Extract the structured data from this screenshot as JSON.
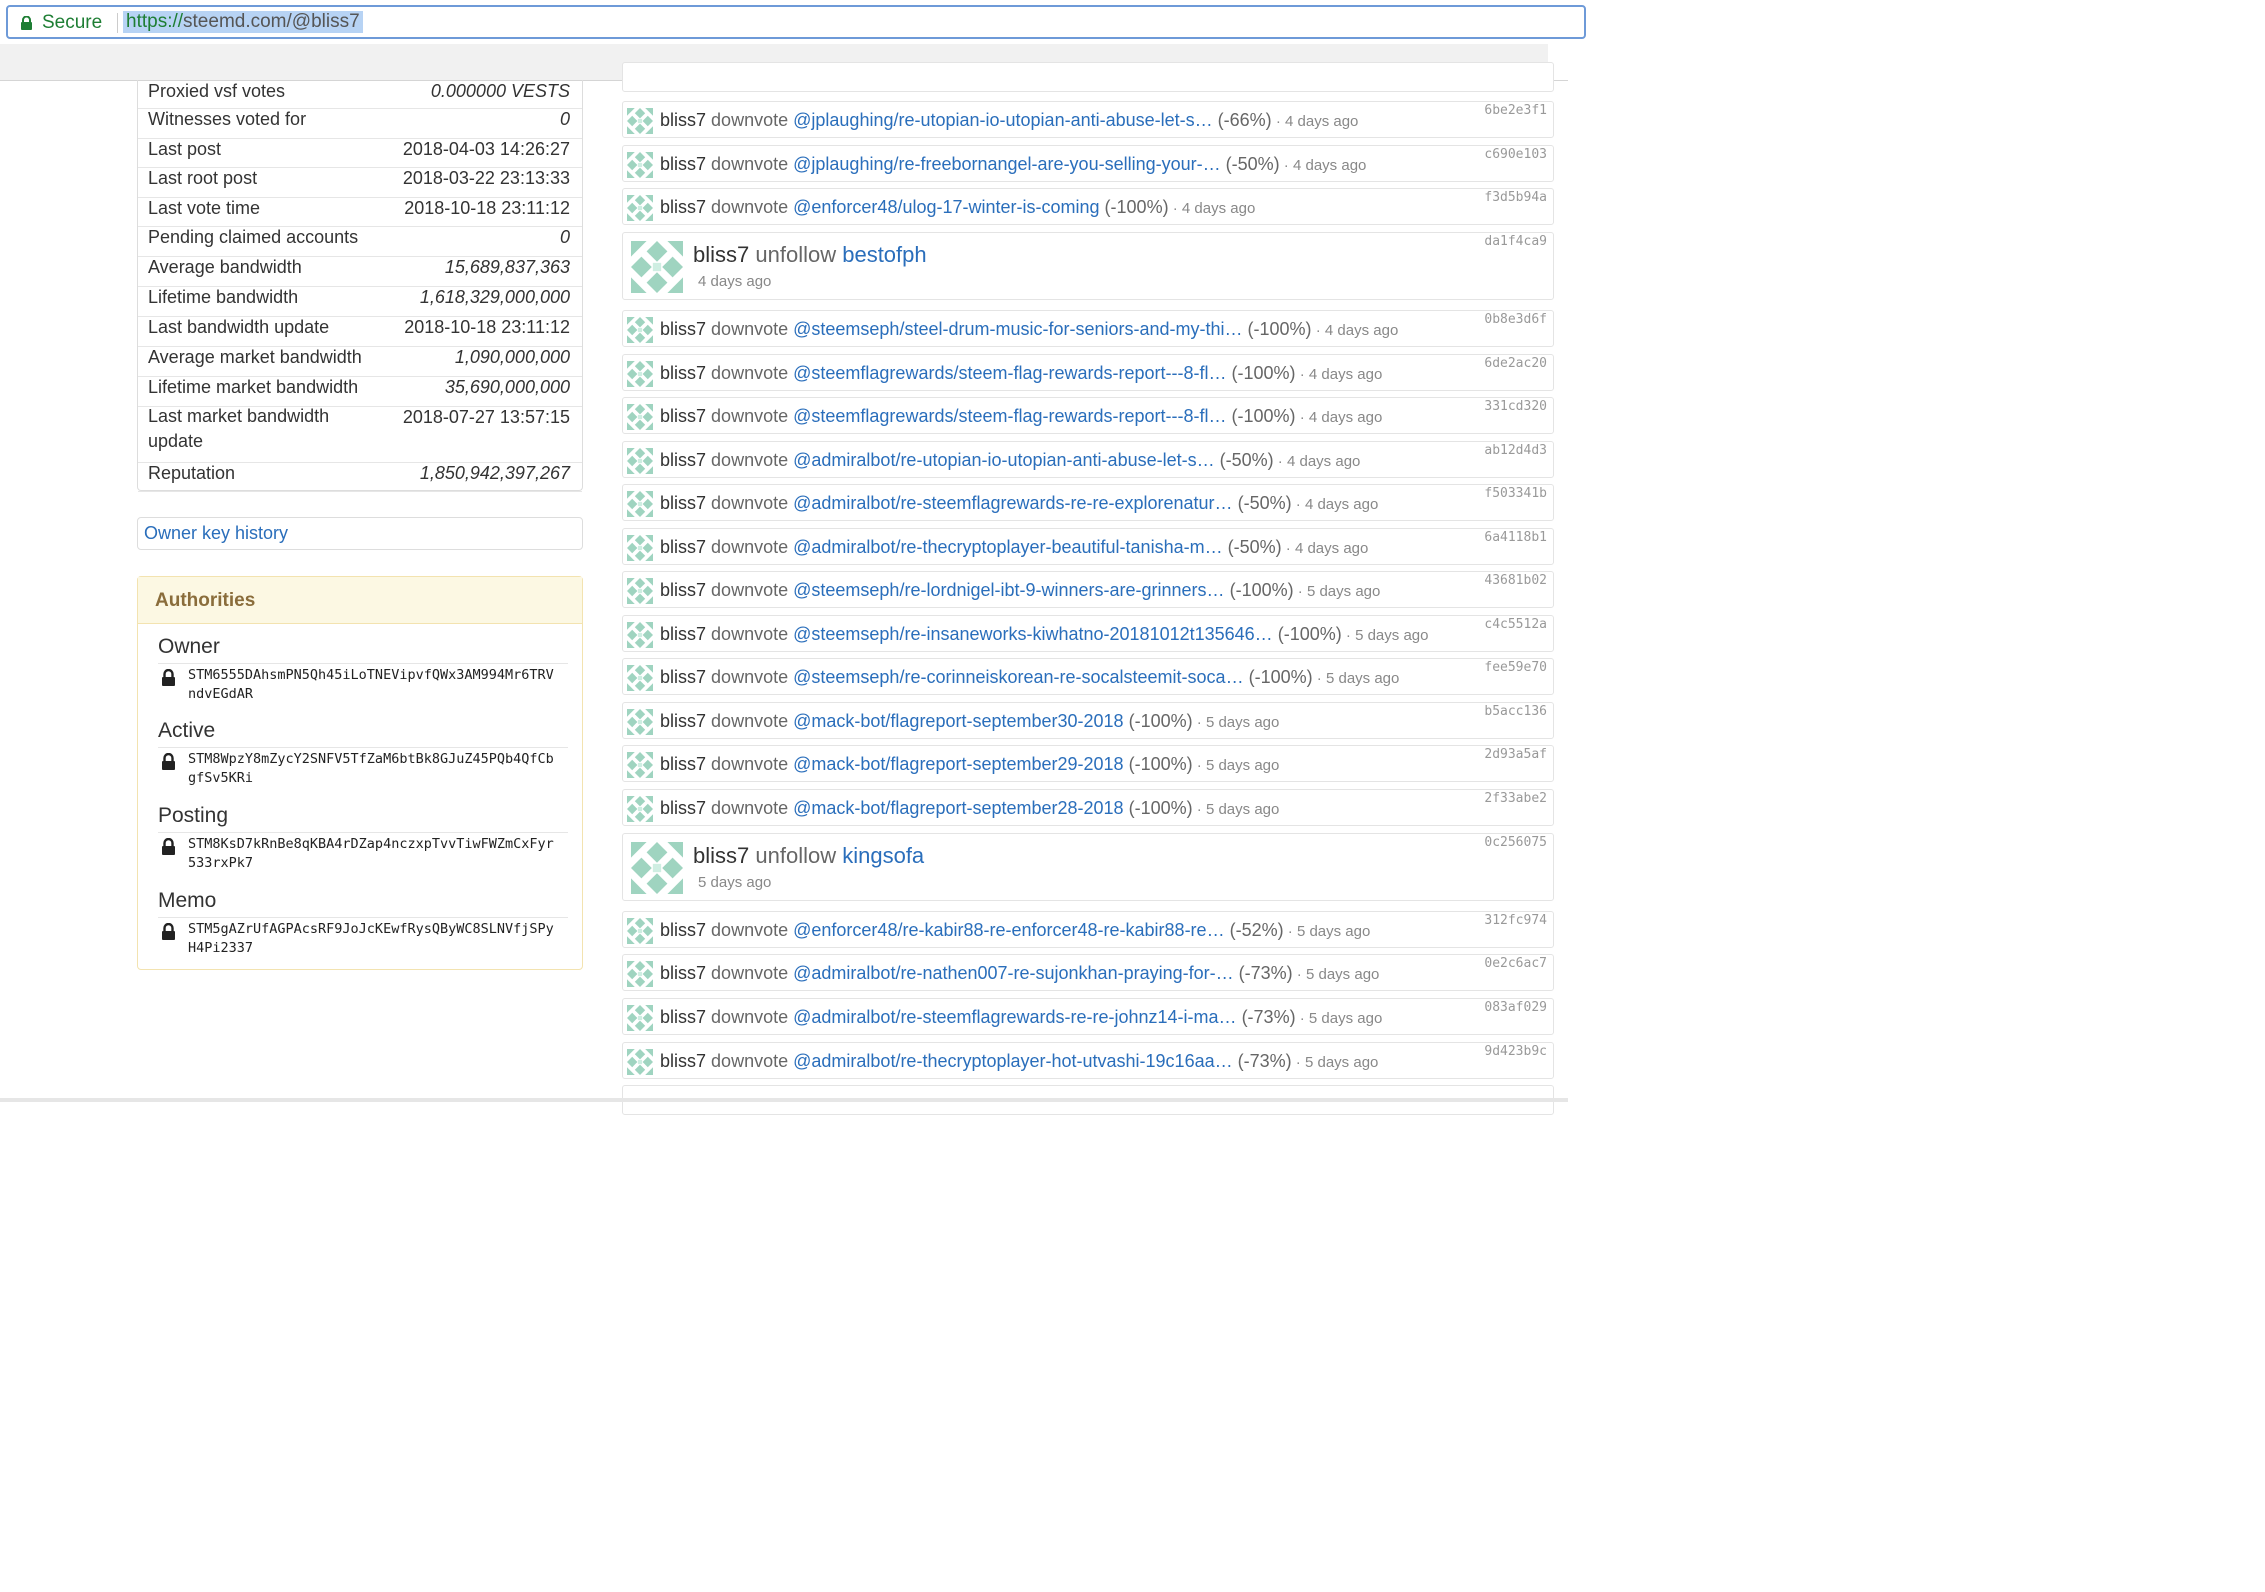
{
  "browser": {
    "secure_label": "Secure",
    "url_protocol": "https://",
    "url_rest": "steemd.com/@bliss7"
  },
  "stats": [
    {
      "label": "Proxied vsf votes",
      "value": "0.000000 VESTS",
      "italic": true
    },
    {
      "label": "Witnesses voted for",
      "value": "0",
      "italic": true
    },
    {
      "label": "Last post",
      "value": "2018-04-03 14:26:27",
      "italic": false
    },
    {
      "label": "Last root post",
      "value": "2018-03-22 23:13:33",
      "italic": false
    },
    {
      "label": "Last vote time",
      "value": "2018-10-18 23:11:12",
      "italic": false
    },
    {
      "label": "Pending claimed accounts",
      "value": "0",
      "italic": true
    },
    {
      "label": "Average bandwidth",
      "value": "15,689,837,363",
      "italic": true
    },
    {
      "label": "Lifetime bandwidth",
      "value": "1,618,329,000,000",
      "italic": true
    },
    {
      "label": "Last bandwidth update",
      "value": "2018-10-18 23:11:12",
      "italic": false
    },
    {
      "label": "Average market bandwidth",
      "value": "1,090,000,000",
      "italic": true
    },
    {
      "label": "Lifetime market bandwidth",
      "value": "35,690,000,000",
      "italic": true
    },
    {
      "label": "Last market bandwidth update",
      "value": "2018-07-27 13:57:15",
      "italic": false
    },
    {
      "label": "Reputation",
      "value": "1,850,942,397,267",
      "italic": true
    }
  ],
  "owner_key_history": "Owner key history",
  "authorities": {
    "title": "Authorities",
    "keys": [
      {
        "name": "Owner",
        "key": "STM6555DAhsmPN5Qh45iLoTNEVipvfQWx3AM994Mr6TRVndvEGdAR"
      },
      {
        "name": "Active",
        "key": "STM8WpzY8mZycY2SNFV5TfZaM6btBk8GJuZ45PQb4QfCbgfSv5KRi"
      },
      {
        "name": "Posting",
        "key": "STM8KsD7kRnBe8qKBA4rDZap4nczxpTvvTiwFWZmCxFyr533rxPk7"
      },
      {
        "name": "Memo",
        "key": "STM5gAZrUfAGPAcsRF9JoJcKEwfRysQByWC8SLNVfjSPyH4Pi2337"
      }
    ]
  },
  "feed": [
    {
      "kind": "vote",
      "who": "bliss7",
      "action": "downvote",
      "link": "@jplaughing/re-utopian-io-utopian-anti-abuse-let-s…",
      "pct": "(-66%)",
      "ago": "4 days ago",
      "hash": "6be2e3f1"
    },
    {
      "kind": "vote",
      "who": "bliss7",
      "action": "downvote",
      "link": "@jplaughing/re-freebornangel-are-you-selling-your-…",
      "pct": "(-50%)",
      "ago": "4 days ago",
      "hash": "c690e103"
    },
    {
      "kind": "vote",
      "who": "bliss7",
      "action": "downvote",
      "link": "@enforcer48/ulog-17-winter-is-coming",
      "pct": "(-100%)",
      "ago": "4 days ago",
      "hash": "f3d5b94a"
    },
    {
      "kind": "follow",
      "who": "bliss7",
      "action": "unfollow",
      "link": "bestofph",
      "ago": "4 days ago",
      "hash": "da1f4ca9"
    },
    {
      "kind": "vote",
      "who": "bliss7",
      "action": "downvote",
      "link": "@steemseph/steel-drum-music-for-seniors-and-my-thi…",
      "pct": "(-100%)",
      "ago": "4 days ago",
      "hash": "0b8e3d6f"
    },
    {
      "kind": "vote",
      "who": "bliss7",
      "action": "downvote",
      "link": "@steemflagrewards/steem-flag-rewards-report---8-fl…",
      "pct": "(-100%)",
      "ago": "4 days ago",
      "hash": "6de2ac20"
    },
    {
      "kind": "vote",
      "who": "bliss7",
      "action": "downvote",
      "link": "@steemflagrewards/steem-flag-rewards-report---8-fl…",
      "pct": "(-100%)",
      "ago": "4 days ago",
      "hash": "331cd320"
    },
    {
      "kind": "vote",
      "who": "bliss7",
      "action": "downvote",
      "link": "@admiralbot/re-utopian-io-utopian-anti-abuse-let-s…",
      "pct": "(-50%)",
      "ago": "4 days ago",
      "hash": "ab12d4d3"
    },
    {
      "kind": "vote",
      "who": "bliss7",
      "action": "downvote",
      "link": "@admiralbot/re-steemflagrewards-re-re-explorenatur…",
      "pct": "(-50%)",
      "ago": "4 days ago",
      "hash": "f503341b"
    },
    {
      "kind": "vote",
      "who": "bliss7",
      "action": "downvote",
      "link": "@admiralbot/re-thecryptoplayer-beautiful-tanisha-m…",
      "pct": "(-50%)",
      "ago": "4 days ago",
      "hash": "6a4118b1"
    },
    {
      "kind": "vote",
      "who": "bliss7",
      "action": "downvote",
      "link": "@steemseph/re-lordnigel-ibt-9-winners-are-grinners…",
      "pct": "(-100%)",
      "ago": "5 days ago",
      "hash": "43681b02"
    },
    {
      "kind": "vote",
      "who": "bliss7",
      "action": "downvote",
      "link": "@steemseph/re-insaneworks-kiwhatno-20181012t135646…",
      "pct": "(-100%)",
      "ago": "5 days ago",
      "hash": "c4c5512a"
    },
    {
      "kind": "vote",
      "who": "bliss7",
      "action": "downvote",
      "link": "@steemseph/re-corinneiskorean-re-socalsteemit-soca…",
      "pct": "(-100%)",
      "ago": "5 days ago",
      "hash": "fee59e70"
    },
    {
      "kind": "vote",
      "who": "bliss7",
      "action": "downvote",
      "link": "@mack-bot/flagreport-september30-2018",
      "pct": "(-100%)",
      "ago": "5 days ago",
      "hash": "b5acc136"
    },
    {
      "kind": "vote",
      "who": "bliss7",
      "action": "downvote",
      "link": "@mack-bot/flagreport-september29-2018",
      "pct": "(-100%)",
      "ago": "5 days ago",
      "hash": "2d93a5af"
    },
    {
      "kind": "vote",
      "who": "bliss7",
      "action": "downvote",
      "link": "@mack-bot/flagreport-september28-2018",
      "pct": "(-100%)",
      "ago": "5 days ago",
      "hash": "2f33abe2"
    },
    {
      "kind": "follow",
      "who": "bliss7",
      "action": "unfollow",
      "link": "kingsofa",
      "ago": "5 days ago",
      "hash": "0c256075"
    },
    {
      "kind": "vote",
      "who": "bliss7",
      "action": "downvote",
      "link": "@enforcer48/re-kabir88-re-enforcer48-re-kabir88-re…",
      "pct": "(-52%)",
      "ago": "5 days ago",
      "hash": "312fc974"
    },
    {
      "kind": "vote",
      "who": "bliss7",
      "action": "downvote",
      "link": "@admiralbot/re-nathen007-re-sujonkhan-praying-for-…",
      "pct": "(-73%)",
      "ago": "5 days ago",
      "hash": "0e2c6ac7"
    },
    {
      "kind": "vote",
      "who": "bliss7",
      "action": "downvote",
      "link": "@admiralbot/re-steemflagrewards-re-re-johnz14-i-ma…",
      "pct": "(-73%)",
      "ago": "5 days ago",
      "hash": "083af029"
    },
    {
      "kind": "vote",
      "who": "bliss7",
      "action": "downvote",
      "link": "@admiralbot/re-thecryptoplayer-hot-utvashi-19c16aa…",
      "pct": "(-73%)",
      "ago": "5 days ago",
      "hash": "9d423b9c"
    }
  ],
  "colors": {
    "link": "#2a6ebb",
    "secure": "#1e7e34",
    "avatar": "#9fd4c0"
  }
}
